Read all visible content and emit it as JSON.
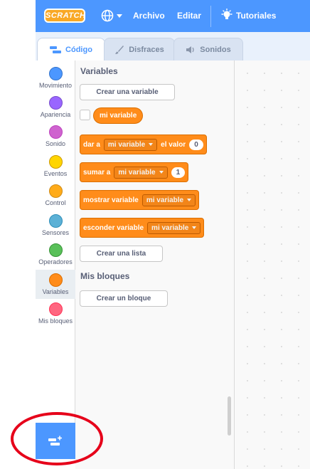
{
  "menubar": {
    "logo_text": "SCRATCH",
    "file_label": "Archivo",
    "edit_label": "Editar",
    "tutorials_label": "Tutoriales",
    "bg_color": "#4c97ff"
  },
  "tabs": [
    {
      "label": "Código",
      "icon": "code-icon",
      "active": true
    },
    {
      "label": "Disfraces",
      "icon": "paintbrush-icon",
      "active": false
    },
    {
      "label": "Sonidos",
      "icon": "speaker-icon",
      "active": false
    }
  ],
  "categories": [
    {
      "label": "Movimiento",
      "color": "#4c97ff",
      "selected": false
    },
    {
      "label": "Apariencia",
      "color": "#9966ff",
      "selected": false
    },
    {
      "label": "Sonido",
      "color": "#cf63cf",
      "selected": false
    },
    {
      "label": "Eventos",
      "color": "#ffd500",
      "selected": false
    },
    {
      "label": "Control",
      "color": "#ffab19",
      "selected": false
    },
    {
      "label": "Sensores",
      "color": "#5cb1d6",
      "selected": false
    },
    {
      "label": "Operadores",
      "color": "#59c059",
      "selected": false
    },
    {
      "label": "Variables",
      "color": "#ff8c1a",
      "selected": true
    },
    {
      "label": "Mis bloques",
      "color": "#ff6680",
      "selected": false
    }
  ],
  "palette": {
    "variables_title": "Variables",
    "create_variable": "Crear una variable",
    "variable_name": "mi variable",
    "block_set": {
      "prefix": "dar a",
      "var": "mi variable",
      "middle": "el valor",
      "value": "0"
    },
    "block_change": {
      "prefix": "sumar a",
      "var": "mi variable",
      "value": "1"
    },
    "block_show": {
      "prefix": "mostrar variable",
      "var": "mi variable"
    },
    "block_hide": {
      "prefix": "esconder variable",
      "var": "mi variable"
    },
    "create_list": "Crear una lista",
    "myblocks_title": "Mis bloques",
    "create_block": "Crear un bloque",
    "block_color": "#ff8c1a"
  },
  "extension_button": {
    "icon": "add-extension-icon",
    "highlight_color": "#e6001a"
  }
}
